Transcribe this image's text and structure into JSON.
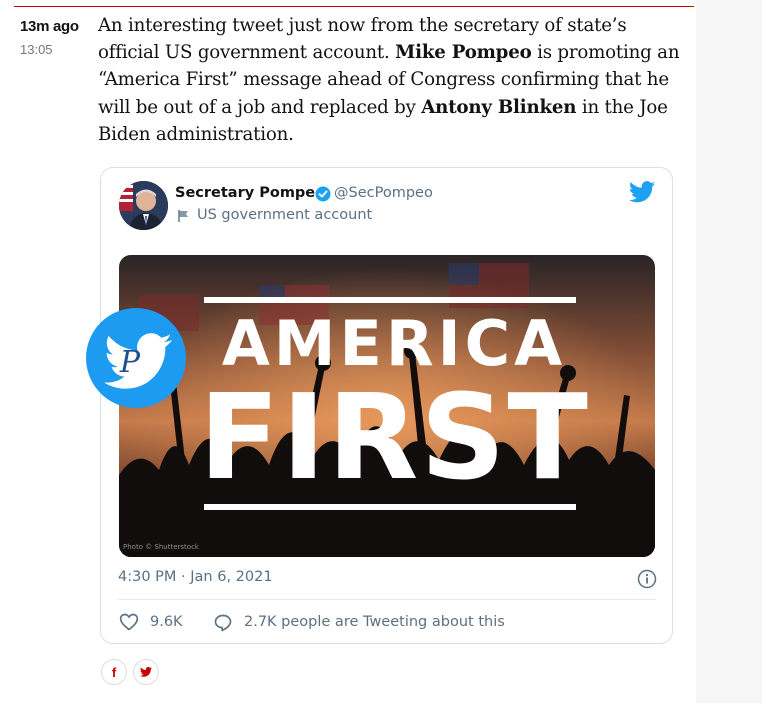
{
  "post": {
    "time_ago": "13m ago",
    "timestamp": "13:05",
    "text_1": "An interesting tweet just now from the secretary of state’s official US government account. ",
    "bold_1": "Mike Pompeo",
    "text_2": " is promoting an “America First” message ahead of Congress confirming that he will be out of a job and replaced by ",
    "bold_2": "Antony Blinken",
    "text_3": " in the Joe Biden administration."
  },
  "tweet": {
    "author_name": "Secretary Pompeo",
    "handle": "@SecPompeo",
    "account_label": "US government account",
    "image_title_line1": "AMERICA",
    "image_title_line2": "FIRST",
    "image_credit": "Photo © Shutterstock",
    "time": "4:30 PM · Jan 6, 2021",
    "likes": "9.6K",
    "tweeting": "2.7K people are Tweeting about this"
  },
  "share": {
    "facebook": "f",
    "twitter_icon": "twitter-bird-icon"
  },
  "colors": {
    "accent_red": "#c70000",
    "twitter_blue": "#1da1f2",
    "muted": "#5b7083"
  }
}
